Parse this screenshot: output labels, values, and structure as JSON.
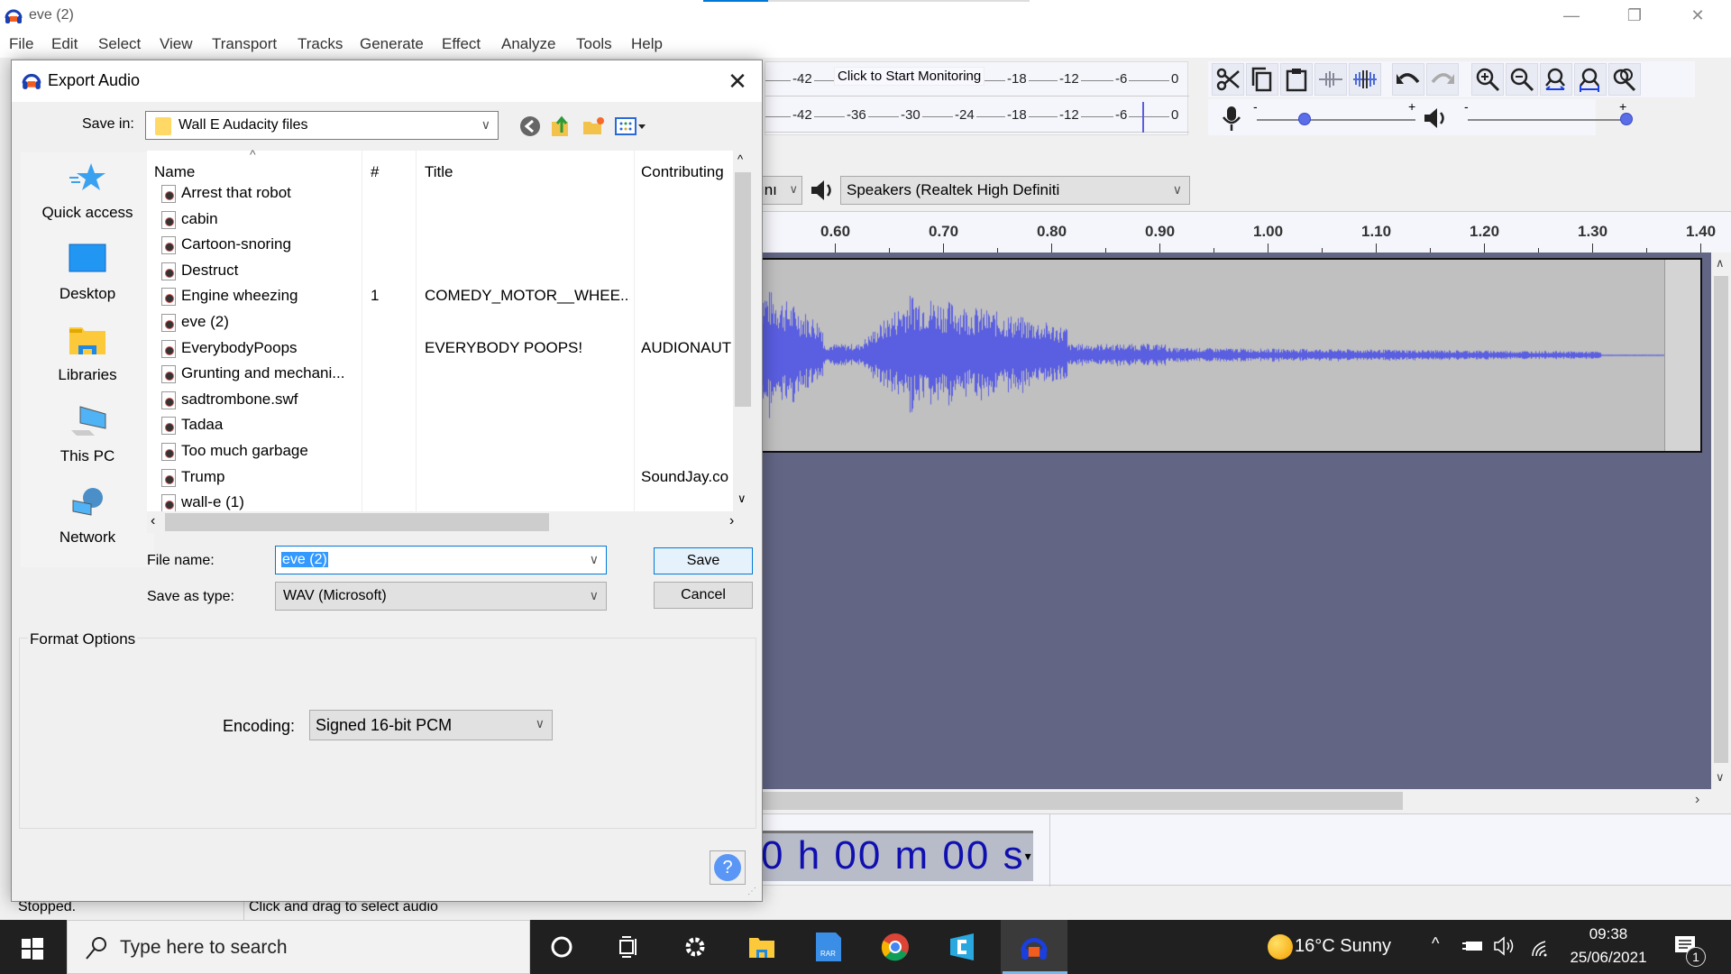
{
  "app": {
    "title": "eve (2)",
    "progress_fraction": 0.2,
    "window_controls": {
      "minimize": "—",
      "restore": "❐",
      "close": "✕"
    }
  },
  "menu": [
    "File",
    "Edit",
    "Select",
    "View",
    "Transport",
    "Tracks",
    "Generate",
    "Effect",
    "Analyze",
    "Tools",
    "Help"
  ],
  "meters": {
    "record_ticks": [
      "-42",
      "-18",
      "-12",
      "-6",
      "0"
    ],
    "monitor_label": "Click to Start Monitoring",
    "playback_ticks": [
      "-42",
      "-36",
      "-30",
      "-24",
      "-18",
      "-12",
      "-6",
      "0"
    ]
  },
  "edit_toolbar": {
    "buttons": [
      "cut-icon",
      "copy-icon",
      "paste-icon",
      "trim-icon",
      "silence-icon",
      "undo-icon",
      "redo-icon",
      "zoom-in-icon",
      "zoom-out-icon",
      "fit-selection-icon",
      "fit-project-icon",
      "zoom-toggle-icon"
    ]
  },
  "mixer": {
    "minus": "-",
    "plus": "+",
    "record_volume": 0.3,
    "playback_volume": 1.0
  },
  "device": {
    "channels_partial": "ını",
    "output_device": "Speakers (Realtek High Definiti"
  },
  "timeline": {
    "ticks": [
      "0.60",
      "0.70",
      "0.80",
      "0.90",
      "1.00",
      "1.10",
      "1.20",
      "1.30",
      "1.40"
    ]
  },
  "time_display": {
    "text": "0 h 00 m 00 s"
  },
  "status": {
    "state": "Stopped.",
    "hint": "Click and drag to select audio"
  },
  "dialog": {
    "title": "Export Audio",
    "close": "✕",
    "save_in_label": "Save in:",
    "save_in_value": "Wall E Audacity files",
    "places": [
      "Quick access",
      "Desktop",
      "Libraries",
      "This PC",
      "Network"
    ],
    "columns": [
      "Name",
      "#",
      "Title",
      "Contributing"
    ],
    "files": [
      {
        "name": "Arrest that robot",
        "num": "",
        "title": "",
        "contrib": ""
      },
      {
        "name": "cabin",
        "num": "",
        "title": "",
        "contrib": ""
      },
      {
        "name": "Cartoon-snoring",
        "num": "",
        "title": "",
        "contrib": ""
      },
      {
        "name": "Destruct",
        "num": "",
        "title": "",
        "contrib": ""
      },
      {
        "name": "Engine wheezing",
        "num": "1",
        "title": "COMEDY_MOTOR__WHEE...",
        "contrib": ""
      },
      {
        "name": "eve (2)",
        "num": "",
        "title": "",
        "contrib": ""
      },
      {
        "name": "EverybodyPoops",
        "num": "",
        "title": "EVERYBODY POOPS!",
        "contrib": "AUDIONAUT"
      },
      {
        "name": "Grunting and mechani...",
        "num": "",
        "title": "",
        "contrib": ""
      },
      {
        "name": "sadtrombone.swf",
        "num": "",
        "title": "",
        "contrib": ""
      },
      {
        "name": "Tadaa",
        "num": "",
        "title": "",
        "contrib": ""
      },
      {
        "name": "Too much garbage",
        "num": "",
        "title": "",
        "contrib": ""
      },
      {
        "name": "Trump",
        "num": "",
        "title": "",
        "contrib": "SoundJay.co"
      },
      {
        "name": "wall-e (1)",
        "num": "",
        "title": "",
        "contrib": ""
      }
    ],
    "file_name_label": "File name:",
    "file_name_value": "eve (2)",
    "save_type_label": "Save as type:",
    "save_type_value": "WAV (Microsoft)",
    "save_button": "Save",
    "cancel_button": "Cancel",
    "format_options_label": "Format Options",
    "encoding_label": "Encoding:",
    "encoding_value": "Signed 16-bit PCM",
    "help": "?"
  },
  "taskbar": {
    "search_placeholder": "Type here to search",
    "weather": "16°C  Sunny",
    "time": "09:38",
    "date": "25/06/2021",
    "notifications": "1"
  },
  "colors": {
    "accent": "#0078d7",
    "waveform": "#5a5ee0",
    "track_bg": "#626584"
  }
}
